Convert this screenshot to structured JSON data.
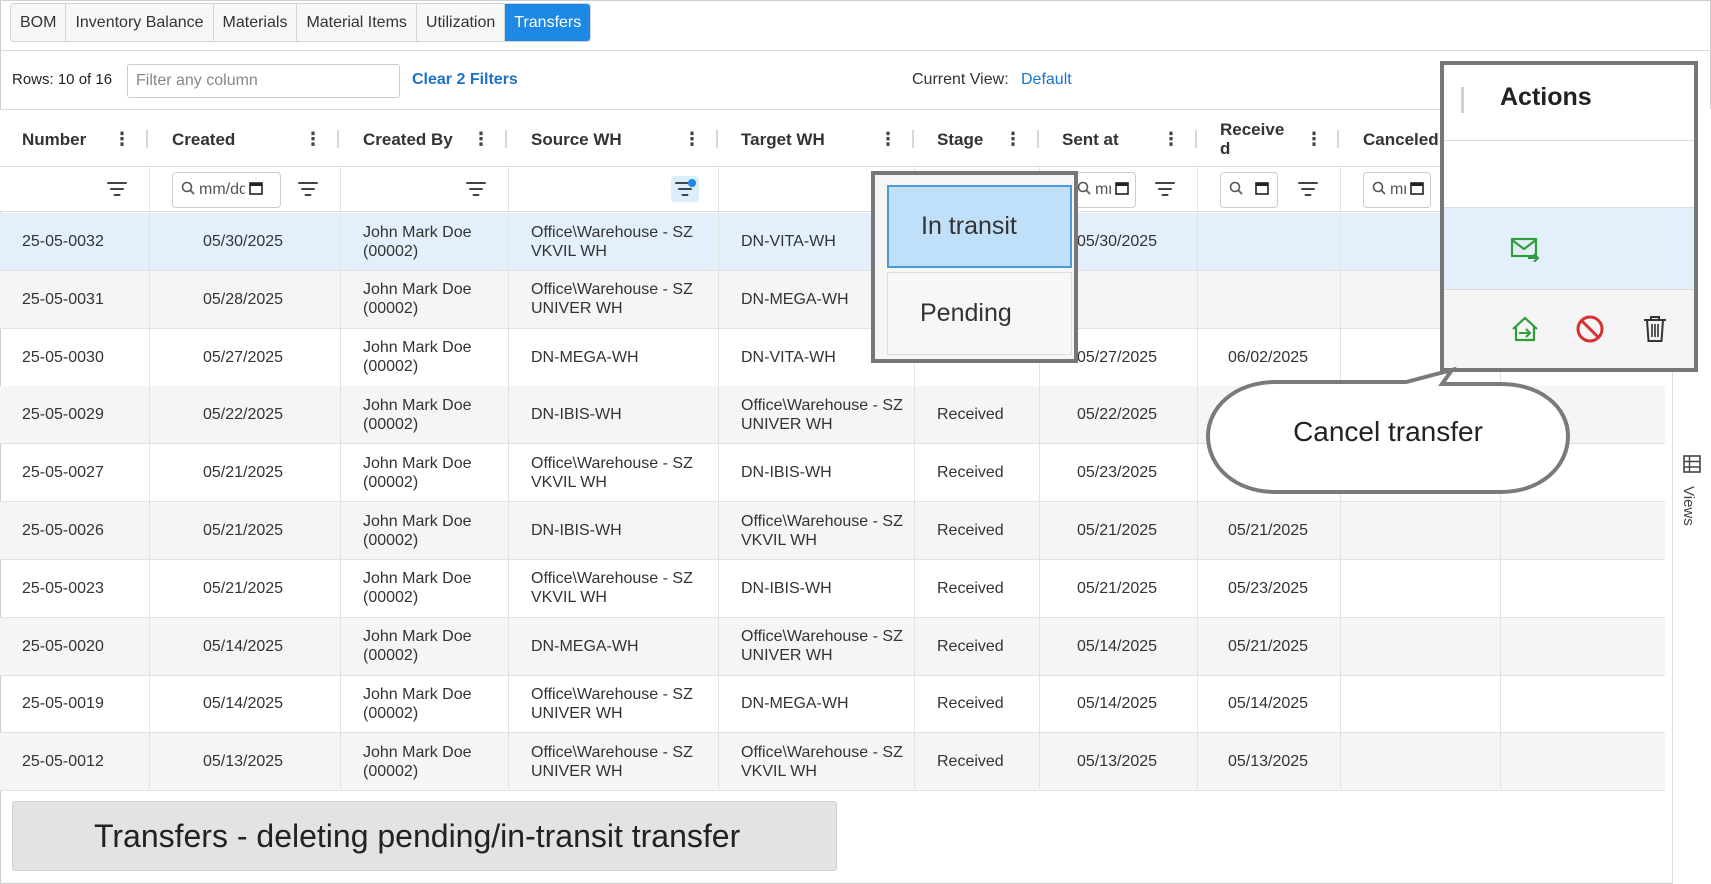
{
  "tabs": [
    {
      "label": "BOM"
    },
    {
      "label": "Inventory Balance"
    },
    {
      "label": "Materials"
    },
    {
      "label": "Material Items"
    },
    {
      "label": "Utilization"
    },
    {
      "label": "Transfers"
    }
  ],
  "active_tab": "Transfers",
  "toolbar": {
    "rows_label": "Rows: 10 of 16",
    "filter_placeholder": "Filter any column",
    "clear_filters": "Clear 2 Filters",
    "current_view_label": "Current View:",
    "current_view_value": "Default"
  },
  "columns": [
    "Number",
    "Created",
    "Created By",
    "Source WH",
    "Target WH",
    "Stage",
    "Sent at",
    "Receive\nd",
    "Canceled"
  ],
  "date_filter_placeholder": "mm/dd/yyyy",
  "rows": [
    {
      "number": "25-05-0032",
      "created": "05/30/2025",
      "created_by": "John Mark Doe (00002)",
      "source": "Office\\Warehouse - SZ VKVIL WH",
      "target": "DN-VITA-WH",
      "stage": "",
      "sent": "05/30/2025",
      "received": "",
      "canceled": ""
    },
    {
      "number": "25-05-0031",
      "created": "05/28/2025",
      "created_by": "John Mark Doe (00002)",
      "source": "Office\\Warehouse - SZ UNIVER WH",
      "target": "DN-MEGA-WH",
      "stage": "",
      "sent": "",
      "received": "",
      "canceled": ""
    },
    {
      "number": "25-05-0030",
      "created": "05/27/2025",
      "created_by": "John Mark Doe (00002)",
      "source": "DN-MEGA-WH",
      "target": "DN-VITA-WH",
      "stage": "",
      "sent": "05/27/2025",
      "received": "06/02/2025",
      "canceled": ""
    },
    {
      "number": "25-05-0029",
      "created": "05/22/2025",
      "created_by": "John Mark Doe (00002)",
      "source": "DN-IBIS-WH",
      "target": "Office\\Warehouse - SZ UNIVER WH",
      "stage": "Received",
      "sent": "05/22/2025",
      "received": "",
      "canceled": ""
    },
    {
      "number": "25-05-0027",
      "created": "05/21/2025",
      "created_by": "John Mark Doe (00002)",
      "source": "Office\\Warehouse - SZ VKVIL WH",
      "target": "DN-IBIS-WH",
      "stage": "Received",
      "sent": "05/23/2025",
      "received": "",
      "canceled": ""
    },
    {
      "number": "25-05-0026",
      "created": "05/21/2025",
      "created_by": "John Mark Doe (00002)",
      "source": "DN-IBIS-WH",
      "target": "Office\\Warehouse - SZ VKVIL WH",
      "stage": "Received",
      "sent": "05/21/2025",
      "received": "05/21/2025",
      "canceled": ""
    },
    {
      "number": "25-05-0023",
      "created": "05/21/2025",
      "created_by": "John Mark Doe (00002)",
      "source": "Office\\Warehouse - SZ VKVIL WH",
      "target": "DN-IBIS-WH",
      "stage": "Received",
      "sent": "05/21/2025",
      "received": "05/23/2025",
      "canceled": ""
    },
    {
      "number": "25-05-0020",
      "created": "05/14/2025",
      "created_by": "John Mark Doe (00002)",
      "source": "DN-MEGA-WH",
      "target": "Office\\Warehouse - SZ UNIVER WH",
      "stage": "Received",
      "sent": "05/14/2025",
      "received": "05/21/2025",
      "canceled": ""
    },
    {
      "number": "25-05-0019",
      "created": "05/14/2025",
      "created_by": "John Mark Doe (00002)",
      "source": "Office\\Warehouse - SZ UNIVER WH",
      "target": "DN-MEGA-WH",
      "stage": "Received",
      "sent": "05/14/2025",
      "received": "05/14/2025",
      "canceled": ""
    },
    {
      "number": "25-05-0012",
      "created": "05/13/2025",
      "created_by": "John Mark Doe (00002)",
      "source": "Office\\Warehouse - SZ UNIVER WH",
      "target": "Office\\Warehouse - SZ VKVIL WH",
      "stage": "Received",
      "sent": "05/13/2025",
      "received": "05/13/2025",
      "canceled": ""
    }
  ],
  "stage_dropdown": {
    "options": [
      "In transit",
      "Pending"
    ],
    "highlighted": "In transit"
  },
  "actions_panel": {
    "title": "Actions",
    "row1_icons": [
      "mail-receive-icon"
    ],
    "row2_icons": [
      "send-out-icon",
      "cancel-icon",
      "trash-icon"
    ]
  },
  "views_label": "Views",
  "callout_text": "Cancel transfer",
  "caption": "Transfers - deleting pending/in-transit transfer",
  "colors": {
    "accent": "#1e88e5",
    "link": "#1a73c8",
    "selected_row": "#e3f0fb",
    "icon_green": "#2e9e3a",
    "icon_red": "#d93030"
  }
}
